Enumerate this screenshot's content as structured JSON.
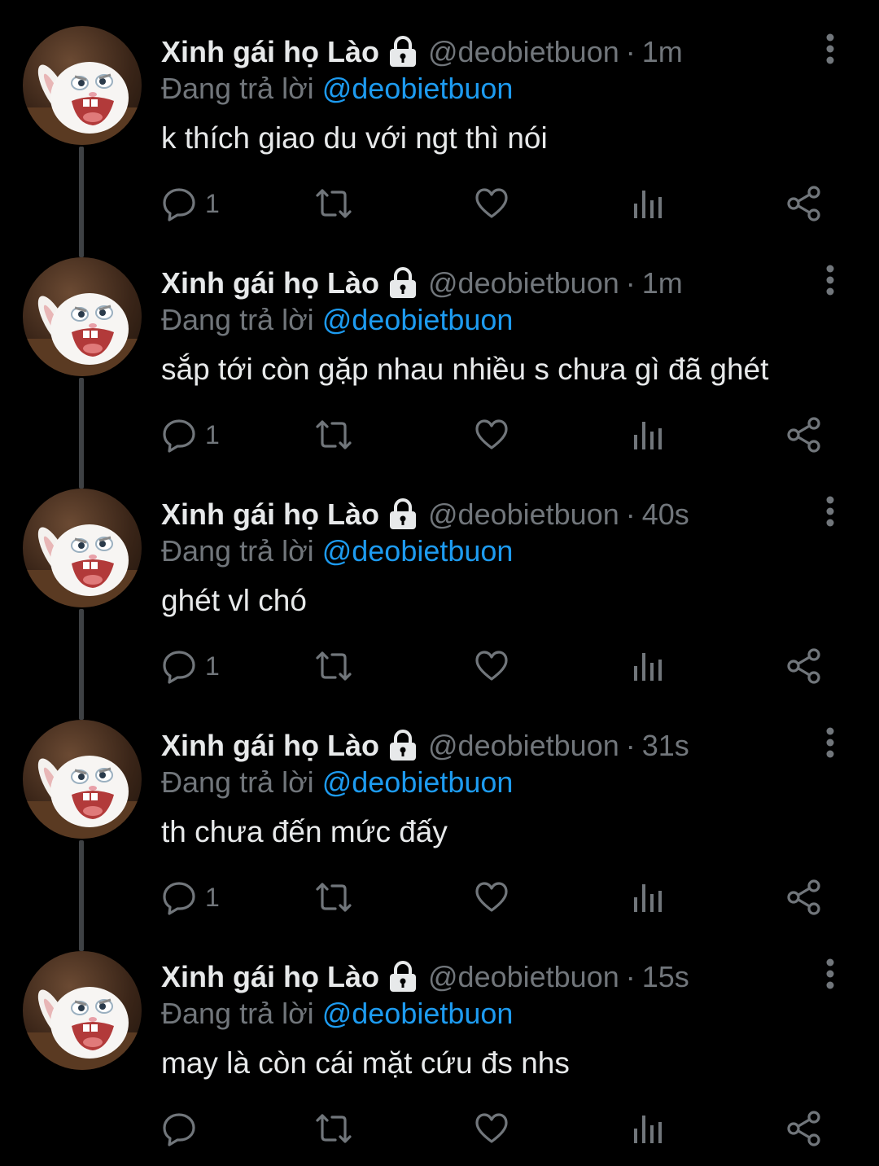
{
  "colors": {
    "background": "#000000",
    "primary_text": "#e7e9ea",
    "secondary_text": "#71767b",
    "link": "#1d9bf0",
    "thread_line": "#3e4144"
  },
  "tweets": [
    {
      "display_name": "Xinh gái họ Lào",
      "handle": "@deobietbuon",
      "separator": "·",
      "time": "1m",
      "reply_prefix": "Đang trả lời",
      "reply_to": "@deobietbuon",
      "text": "k thích giao du với ngt thì nói",
      "reply_count": "1",
      "icons": [
        "lock-icon",
        "more-vertical-icon",
        "reply-icon",
        "retweet-icon",
        "like-icon",
        "views-icon",
        "share-icon"
      ]
    },
    {
      "display_name": "Xinh gái họ Lào",
      "handle": "@deobietbuon",
      "separator": "·",
      "time": "1m",
      "reply_prefix": "Đang trả lời",
      "reply_to": "@deobietbuon",
      "text": "sắp tới còn gặp nhau nhiều s chưa gì đã ghét",
      "reply_count": "1",
      "icons": [
        "lock-icon",
        "more-vertical-icon",
        "reply-icon",
        "retweet-icon",
        "like-icon",
        "views-icon",
        "share-icon"
      ]
    },
    {
      "display_name": "Xinh gái họ Lào",
      "handle": "@deobietbuon",
      "separator": "·",
      "time": "40s",
      "reply_prefix": "Đang trả lời",
      "reply_to": "@deobietbuon",
      "text": "ghét vl chó",
      "reply_count": "1",
      "icons": [
        "lock-icon",
        "more-vertical-icon",
        "reply-icon",
        "retweet-icon",
        "like-icon",
        "views-icon",
        "share-icon"
      ]
    },
    {
      "display_name": "Xinh gái họ Lào",
      "handle": "@deobietbuon",
      "separator": "·",
      "time": "31s",
      "reply_prefix": "Đang trả lời",
      "reply_to": "@deobietbuon",
      "text": "th chưa đến mức đấy",
      "reply_count": "1",
      "icons": [
        "lock-icon",
        "more-vertical-icon",
        "reply-icon",
        "retweet-icon",
        "like-icon",
        "views-icon",
        "share-icon"
      ]
    },
    {
      "display_name": "Xinh gái họ Lào",
      "handle": "@deobietbuon",
      "separator": "·",
      "time": "15s",
      "reply_prefix": "Đang trả lời",
      "reply_to": "@deobietbuon",
      "text": "may là còn cái mặt cứu đs nhs",
      "reply_count": "",
      "icons": [
        "lock-icon",
        "more-vertical-icon",
        "reply-icon",
        "retweet-icon",
        "like-icon",
        "views-icon",
        "share-icon"
      ]
    }
  ]
}
